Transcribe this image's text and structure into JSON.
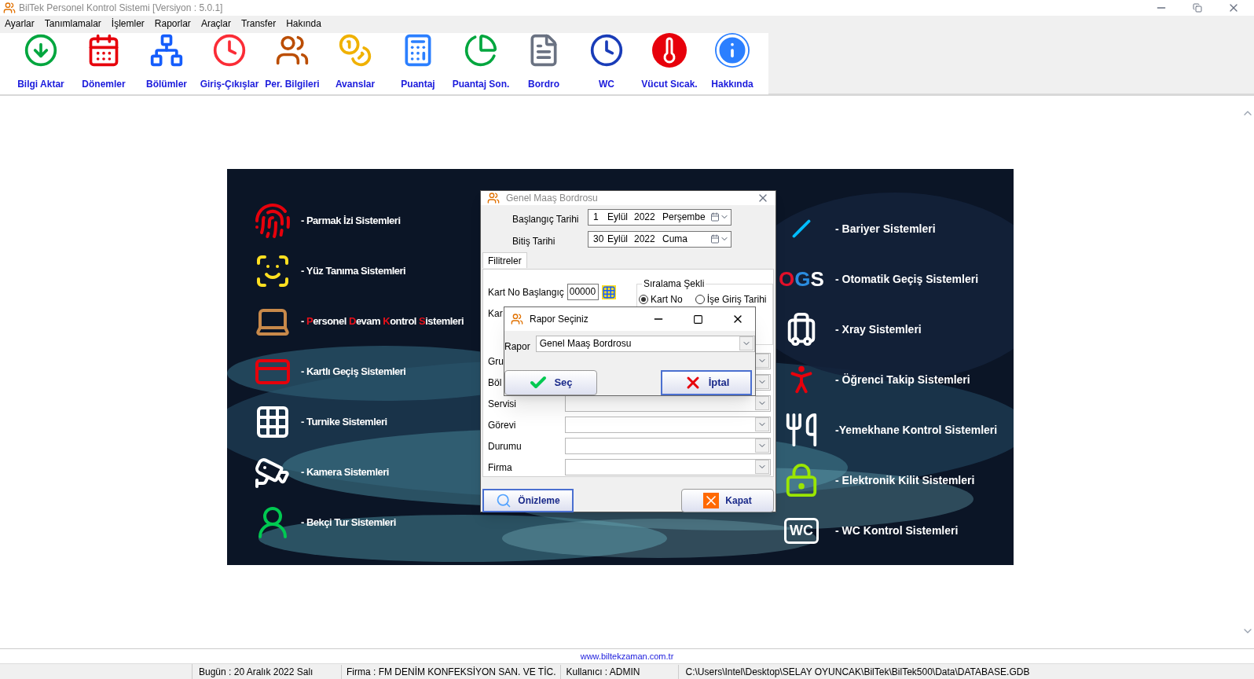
{
  "window": {
    "title": "BilTek Personel Kontrol Sistemi [Versiyon : 5.0.1]"
  },
  "menu": [
    "Ayarlar",
    "Tanımlamalar",
    "İşlemler",
    "Raporlar",
    "Araçlar",
    "Transfer",
    "Hakında"
  ],
  "toolbar": [
    {
      "label": "Bilgi Aktar"
    },
    {
      "label": "Dönemler"
    },
    {
      "label": "Bölümler"
    },
    {
      "label": "Giriş-Çıkışlar"
    },
    {
      "label": "Per. Bilgileri"
    },
    {
      "label": "Avanslar"
    },
    {
      "label": "Puantaj"
    },
    {
      "label": "Puantaj Son."
    },
    {
      "label": "Bordro"
    },
    {
      "label": "WC"
    },
    {
      "label": "Vücut Sıcak."
    },
    {
      "label": "Hakkında"
    }
  ],
  "banner": {
    "left": [
      {
        "text": "- Parmak İzi Sistemleri"
      },
      {
        "text": "- Yüz Tanıma Sistemleri"
      },
      {
        "parts": [
          {
            "text": "- ",
            "highlight": false
          },
          {
            "text": "P",
            "highlight": true
          },
          {
            "text": "ersonel ",
            "highlight": false
          },
          {
            "text": "D",
            "highlight": true
          },
          {
            "text": "evam ",
            "highlight": false
          },
          {
            "text": "K",
            "highlight": true
          },
          {
            "text": "ontrol ",
            "highlight": false
          },
          {
            "text": "S",
            "highlight": true
          },
          {
            "text": "istemleri",
            "highlight": false
          }
        ]
      },
      {
        "text": "- Kartlı Geçiş Sistemleri"
      },
      {
        "text": "- Turnike Sistemleri"
      },
      {
        "text": "- Kamera Sistemleri"
      },
      {
        "text": "- Bekçi Tur Sistemleri"
      }
    ],
    "right": [
      {
        "text": "- Bariyer Sistemleri"
      },
      {
        "text": "- Otomatik Geçiş Sistemleri",
        "logo": [
          {
            "text": "O",
            "color": "#e3102a"
          },
          {
            "text": "G",
            "color": "#2b8de0"
          },
          {
            "text": "S",
            "color": "#ffffff"
          }
        ]
      },
      {
        "text": "- Xray Sistemleri"
      },
      {
        "text": "- Öğrenci Takip Sistemleri"
      },
      {
        "text": "-Yemekhane Kontrol Sistemleri"
      },
      {
        "text": "- Elektronik Kilit Sistemleri"
      },
      {
        "text": "- WC Kontrol Sistemleri",
        "badge": "WC"
      }
    ]
  },
  "dialog": {
    "title": "Genel Maaş Bordrosu",
    "dates": [
      {
        "label": "Başlangıç Tarihi",
        "day": "1",
        "month": "Eylül",
        "year": "2022",
        "weekday": "Perşembe"
      },
      {
        "label": "Bitiş Tarihi",
        "day": "30",
        "month": "Eylül",
        "year": "2022",
        "weekday": "Cuma"
      }
    ],
    "tab": {
      "label": "Filitreler",
      "selected": true
    },
    "card_start": {
      "label": "Kart No Başlangıç",
      "value": "00000"
    },
    "card_end_label": "Kar",
    "sort": {
      "title": "Sıralama Şekli",
      "options": [
        {
          "label": "Kart No",
          "selected": true
        },
        {
          "label": "İşe Giriş Tarihi",
          "selected": false
        }
      ]
    },
    "filters": [
      {
        "label": "Gru"
      },
      {
        "label": "Böl"
      },
      {
        "label": "Servisi"
      },
      {
        "label": "Görevi"
      },
      {
        "label": "Durumu"
      },
      {
        "label": "Firma"
      }
    ],
    "buttons": [
      {
        "label": "Önizleme"
      },
      {
        "label": "Kapat"
      }
    ]
  },
  "report_dialog": {
    "title": "Rapor Seçiniz",
    "label": "Rapor",
    "value": "Genel Maaş Bordrosu",
    "buttons": [
      {
        "label": "Seç"
      },
      {
        "label": "İptal"
      }
    ]
  },
  "status": {
    "link": "www.biltekzaman.com.tr",
    "date": "Bugün : 20 Aralık 2022 Salı",
    "firm": "Firma : FM DENİM KONFEKSİYON SAN. VE TİC.",
    "user": "Kullanıcı : ADMIN",
    "path": "C:\\Users\\Intel\\Desktop\\SELAY OYUNCAK\\BilTek\\BilTek500\\Data\\DATABASE.GDB"
  }
}
